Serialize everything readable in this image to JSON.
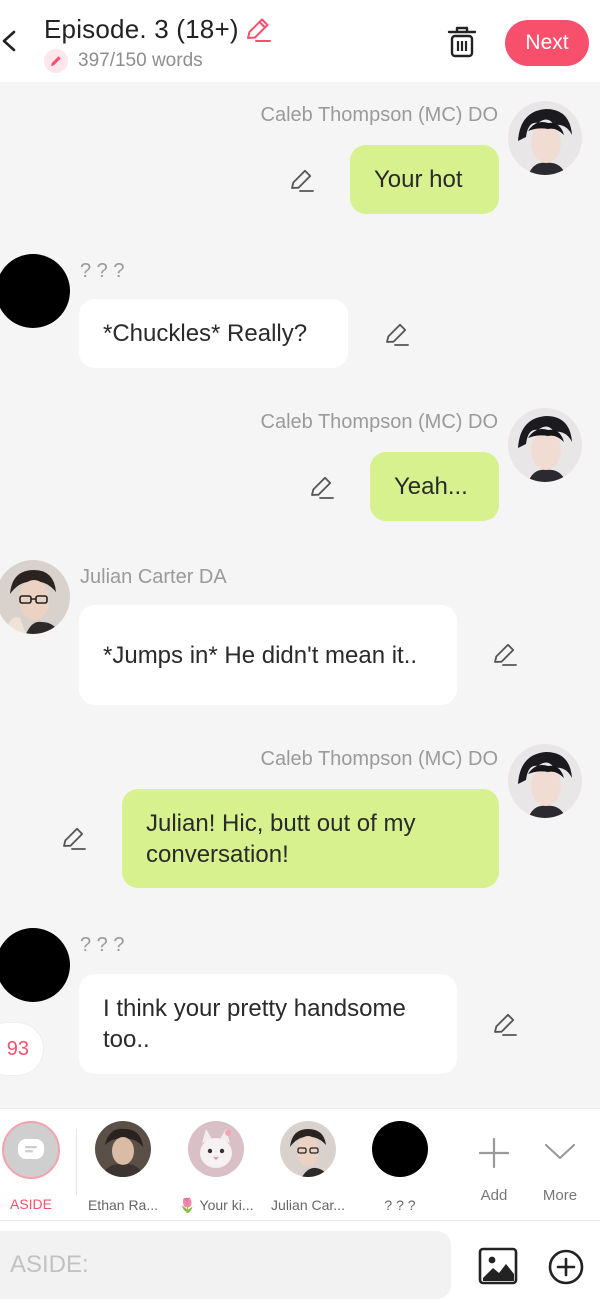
{
  "header": {
    "title": "Episode. 3 (18+)",
    "word_count": "397/150 words",
    "next_label": "Next",
    "accent_color": "#f8506c"
  },
  "messages": [
    {
      "sender": "Caleb Thompson (MC) DO",
      "text": "Your hot",
      "side": "right",
      "avatar": "caleb-avatar"
    },
    {
      "sender": "? ? ?",
      "text": "*Chuckles* Really?",
      "side": "left",
      "avatar": "unknown-avatar"
    },
    {
      "sender": "Caleb Thompson (MC) DO",
      "text": "Yeah...",
      "side": "right",
      "avatar": "caleb-avatar"
    },
    {
      "sender": "Julian Carter DA",
      "text": "*Jumps in* He didn't mean it..",
      "side": "left",
      "avatar": "julian-avatar"
    },
    {
      "sender": "Caleb Thompson (MC) DO",
      "text": "Julian! Hic, butt out of my conversation!",
      "side": "right",
      "avatar": "caleb-avatar"
    },
    {
      "sender": "? ? ?",
      "text": "I think your pretty handsome too..",
      "side": "left",
      "avatar": "unknown-avatar"
    }
  ],
  "side_pill_text": "93",
  "characters": {
    "aside_label": "ASIDE",
    "items": [
      {
        "name": "Ethan Ra...",
        "avatar": "ethan-avatar"
      },
      {
        "name": "🌷 Your ki...",
        "avatar": "cat-avatar"
      },
      {
        "name": "Julian Car...",
        "avatar": "julian-avatar"
      },
      {
        "name": "? ? ?",
        "avatar": "unknown-avatar"
      }
    ],
    "add_label": "Add",
    "more_label": "More"
  },
  "input": {
    "placeholder": "ASIDE:",
    "value": ""
  },
  "colors": {
    "mc_bubble": "#d7f18f",
    "other_bubble": "#ffffff",
    "background": "#f5f5f5"
  }
}
